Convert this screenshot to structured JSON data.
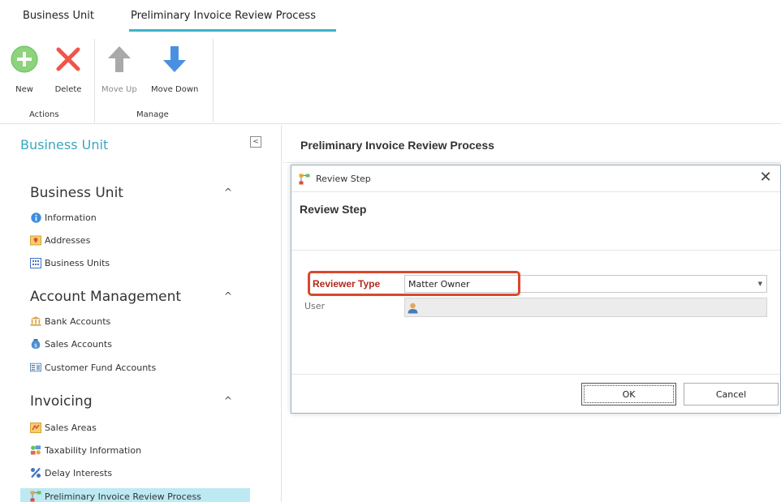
{
  "ribbon_tabs": [
    "Business Unit",
    "Preliminary Invoice Review Process"
  ],
  "toolbar": {
    "new_label": "New",
    "delete_label": "Delete",
    "move_up_label": "Move Up",
    "move_down_label": "Move Down",
    "group_actions": "Actions",
    "group_manage": "Manage"
  },
  "nav": {
    "title": "Business Unit",
    "collapse_glyph": "<",
    "sections": [
      {
        "title": "Business Unit",
        "items": [
          {
            "label": "Information",
            "icon": "info-icon"
          },
          {
            "label": "Addresses",
            "icon": "address-icon"
          },
          {
            "label": "Business Units",
            "icon": "business-units-icon"
          }
        ]
      },
      {
        "title": "Account Management",
        "items": [
          {
            "label": "Bank Accounts",
            "icon": "bank-icon"
          },
          {
            "label": "Sales Accounts",
            "icon": "sales-account-icon"
          },
          {
            "label": "Customer Fund Accounts",
            "icon": "fund-account-icon"
          }
        ]
      },
      {
        "title": "Invoicing",
        "items": [
          {
            "label": "Sales Areas",
            "icon": "sales-area-icon"
          },
          {
            "label": "Taxability Information",
            "icon": "taxability-icon"
          },
          {
            "label": "Delay Interests",
            "icon": "percent-icon"
          },
          {
            "label": "Preliminary Invoice Review Process",
            "icon": "review-process-icon",
            "selected": true
          }
        ]
      }
    ],
    "chevron_glyph": "^"
  },
  "content": {
    "title": "Preliminary Invoice Review Process"
  },
  "dialog": {
    "window_title": "Review Step",
    "header": "Review Step",
    "close_glyph": "✕",
    "reviewer_type_label": "Reviewer Type",
    "reviewer_type_value": "Matter Owner",
    "user_label": "User",
    "ok_label": "OK",
    "cancel_label": "Cancel"
  },
  "colors": {
    "accent": "#3aa7c1",
    "selected_bg": "#bde9f3",
    "highlight": "#d9482b",
    "label_red": "#b02a1e"
  }
}
